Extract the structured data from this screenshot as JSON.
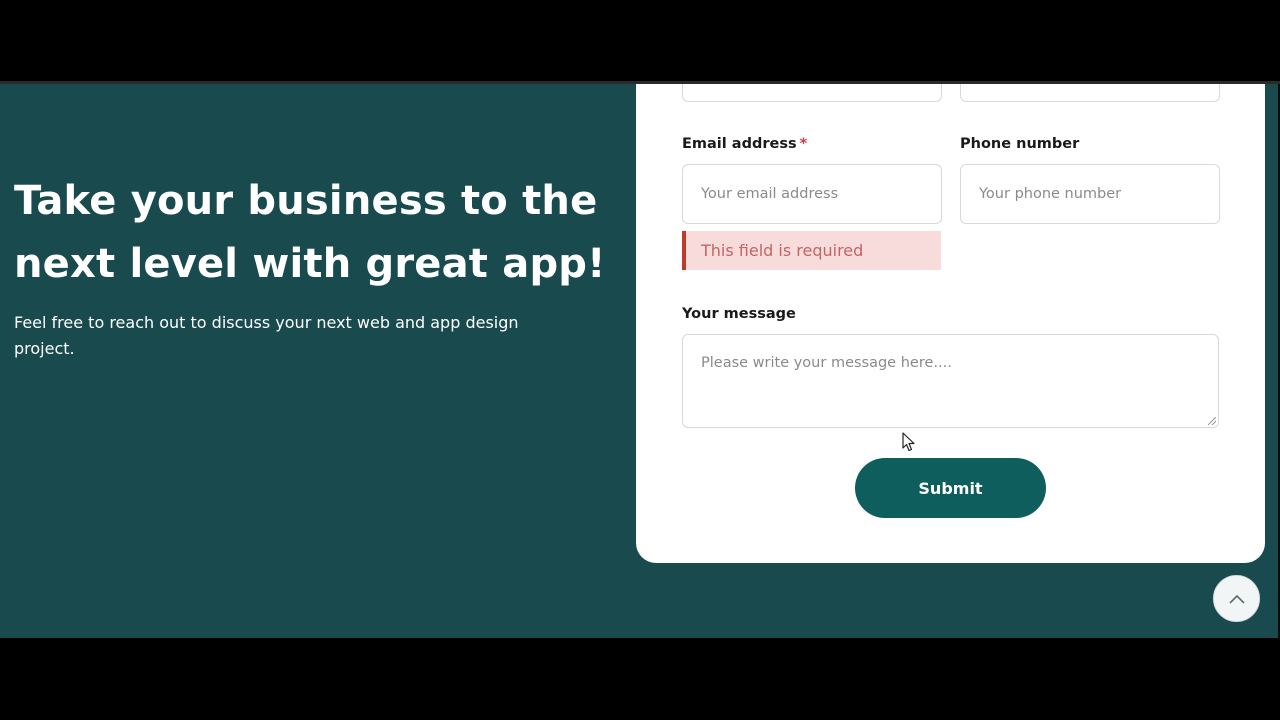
{
  "hero": {
    "title": "Take your business to the next level with great app!",
    "subtitle": "Feel free to reach out to discuss your next web and app design project."
  },
  "form": {
    "email": {
      "label": "Email address",
      "required_mark": "*",
      "placeholder": "Your email address",
      "error": "This field is required"
    },
    "phone": {
      "label": "Phone number",
      "placeholder": "Your phone number"
    },
    "message": {
      "label": "Your message",
      "placeholder": "Please write your message here...."
    },
    "submit_label": "Submit"
  },
  "colors": {
    "section_bg": "#184a4e",
    "button": "#0d5e5d",
    "error_bg": "#f8dcdc",
    "error_border": "#c0392b"
  },
  "icons": {
    "scroll_top": "chevron-up-icon",
    "cursor": "mouse-pointer-icon"
  }
}
